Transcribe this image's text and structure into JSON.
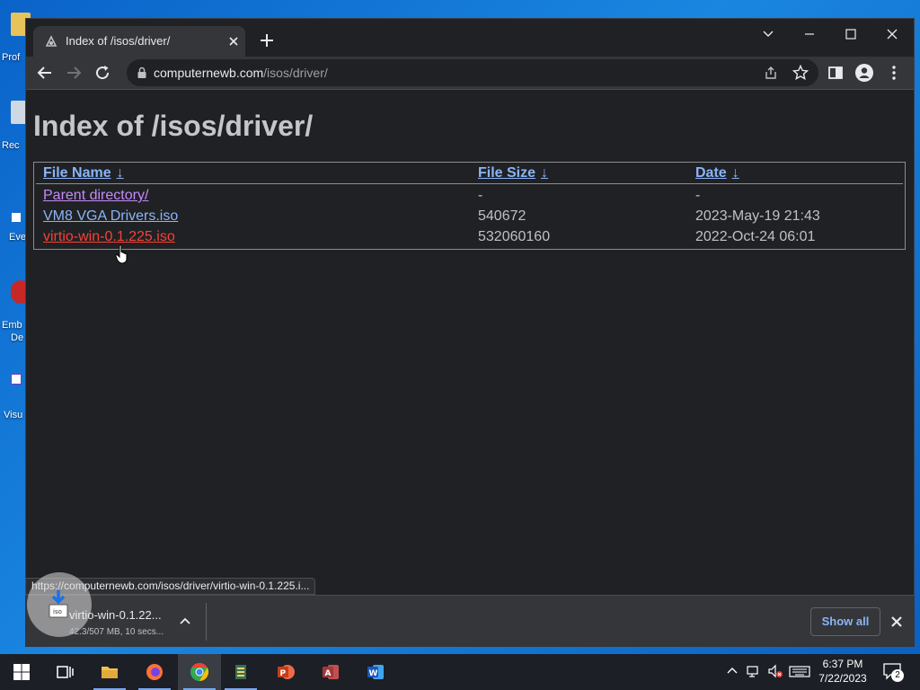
{
  "desktop": {
    "icons": [
      {
        "label": "Prof"
      },
      {
        "label": "Rec"
      },
      {
        "label": "Eve"
      },
      {
        "label": "Emb"
      },
      {
        "label": "De"
      },
      {
        "label": "Visu"
      }
    ]
  },
  "browser": {
    "tab": {
      "title": "Index of /isos/driver/"
    },
    "address": {
      "host": "computernewb.com",
      "path": "/isos/driver/"
    }
  },
  "page": {
    "heading": "Index of /isos/driver/",
    "columns": {
      "name": "File Name",
      "size": "File Size",
      "date": "Date",
      "sort_glyph": "↓"
    },
    "rows": [
      {
        "name": "Parent directory/",
        "size": "-",
        "date": "-"
      },
      {
        "name": "VM8 VGA Drivers.iso",
        "size": "540672",
        "date": "2023-May-19 21:43"
      },
      {
        "name": "virtio-win-0.1.225.iso",
        "size": "532060160",
        "date": "2022-Oct-24 06:01"
      }
    ]
  },
  "status_bubble": {
    "url": "https://computernewb.com/isos/driver/virtio-win-0.1.225.i..."
  },
  "download_shelf": {
    "item": {
      "name": "virtio-win-0.1.22...",
      "progress": "42.3/507 MB, 10 secs..."
    },
    "show_all_label": "Show all"
  },
  "taskbar": {
    "apps": [
      "Task View",
      "File Explorer",
      "Firefox",
      "Google Chrome",
      "Archive Tool",
      "PowerPoint",
      "Access",
      "Word"
    ],
    "active_app": "Google Chrome",
    "clock": {
      "time": "6:37 PM",
      "date": "7/22/2023"
    },
    "notification_count": "2"
  },
  "colors": {
    "link": "#8ab4f8",
    "visited_link": "#c58af9",
    "active_link": "#f44336",
    "page_bg": "#202124"
  }
}
